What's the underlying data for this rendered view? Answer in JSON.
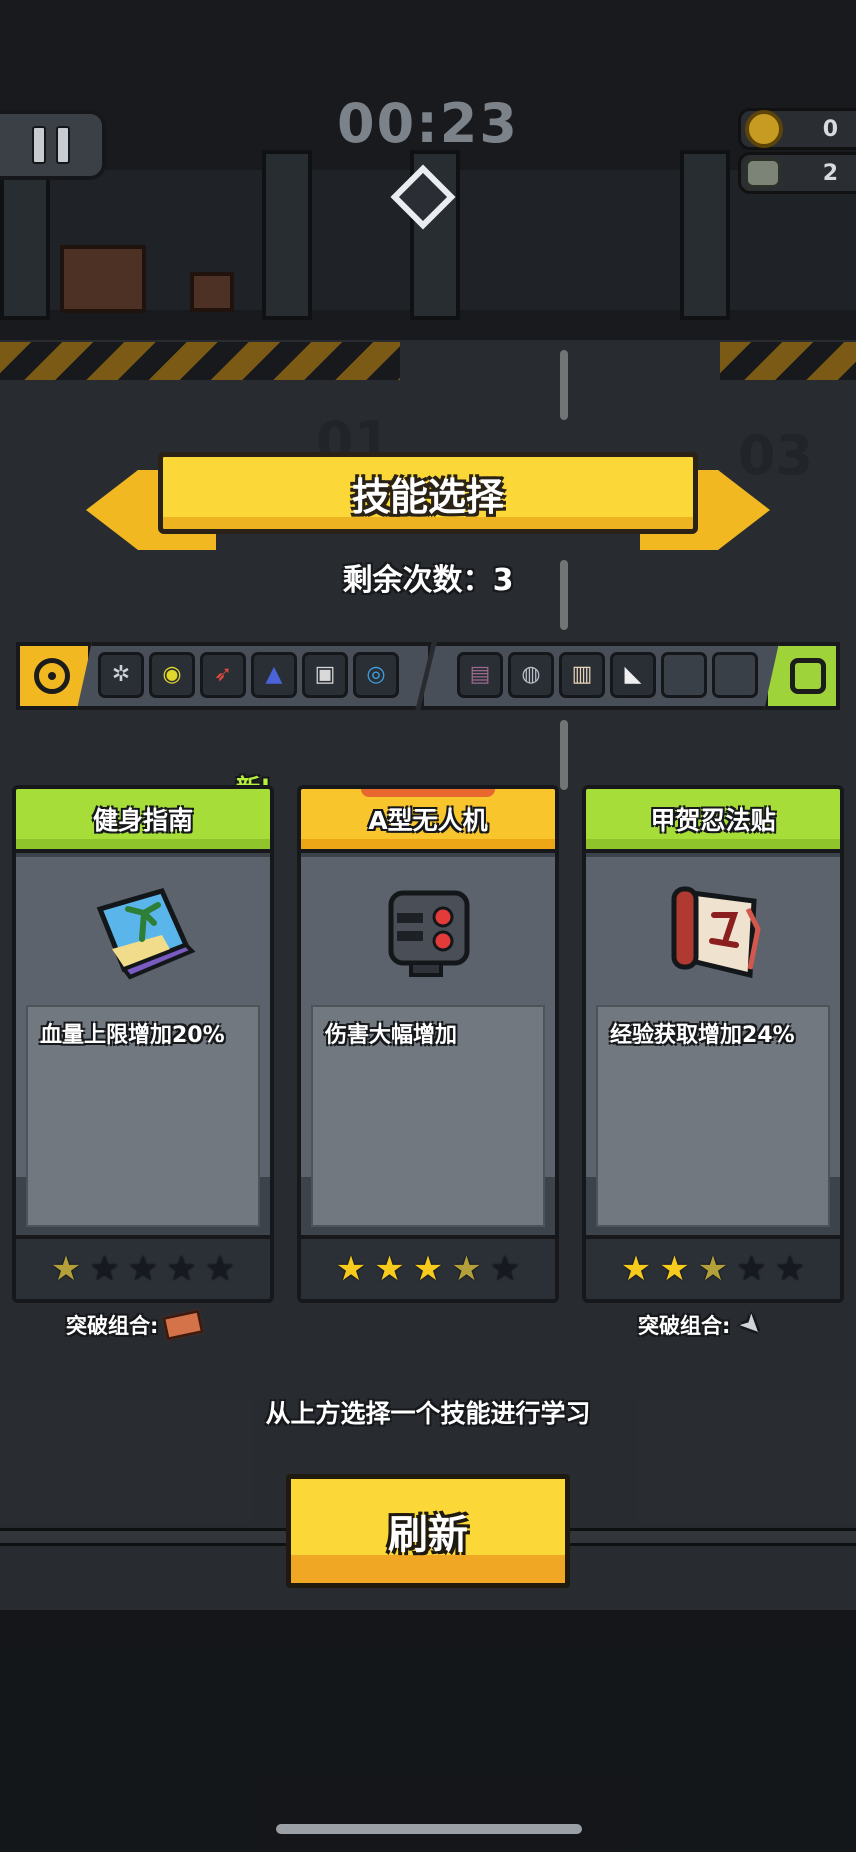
{
  "hud": {
    "timer": "00:23",
    "coins": "0",
    "kills": "2"
  },
  "background": {
    "lane_left": "01",
    "lane_right": "03"
  },
  "skill_select": {
    "title": "技能选择",
    "remaining_label": "剩余次数：",
    "remaining_count": "3",
    "hint": "从上方选择一个技能进行学习",
    "refresh_label": "刷新"
  },
  "equipment": {
    "weapon_slots": [
      "shuriken-icon",
      "saw-blade-icon",
      "rocket-icon",
      "cone-icon",
      "drone-icon",
      "disc-icon"
    ],
    "passive_slots": [
      "vest-icon",
      "orb-icon",
      "scroll-icon",
      "sneaker-icon",
      "empty",
      "empty"
    ]
  },
  "cards": [
    {
      "name": "健身指南",
      "badge": "新!",
      "icon": "fitness-book-icon",
      "description": "血量上限增加20%",
      "stars": 1,
      "max_stars": 5,
      "breakthrough_label": "突破组合:",
      "breakthrough_icon": "brick-icon"
    },
    {
      "name": "A型无人机",
      "badge": "",
      "icon": "drone-a-icon",
      "description": "伤害大幅增加",
      "stars": 4,
      "max_stars": 5,
      "breakthrough_label": "",
      "breakthrough_icon": ""
    },
    {
      "name": "甲贺忍法贴",
      "badge": "",
      "icon": "ninja-scroll-icon",
      "description": "经验获取增加24%",
      "stars": 3,
      "max_stars": 5,
      "breakthrough_label": "突破组合:",
      "breakthrough_icon": "kunai-icon"
    }
  ],
  "colors": {
    "accent_yellow": "#fbd838",
    "accent_green": "#a6dd38",
    "star_on": "#f7cb1d"
  }
}
